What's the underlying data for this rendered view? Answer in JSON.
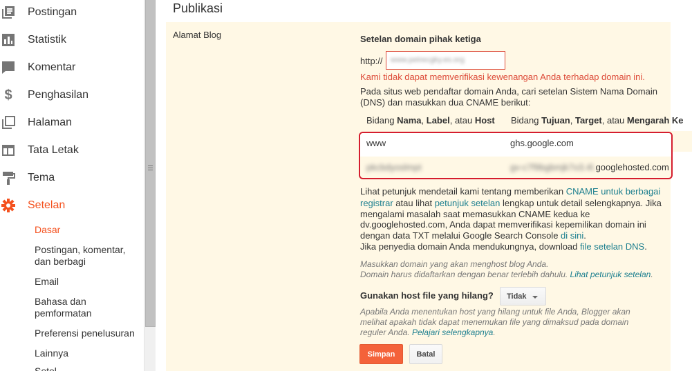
{
  "sidebar": {
    "items": [
      {
        "label": "Postingan",
        "icon": "posts-icon"
      },
      {
        "label": "Statistik",
        "icon": "stats-icon"
      },
      {
        "label": "Komentar",
        "icon": "comments-icon"
      },
      {
        "label": "Penghasilan",
        "icon": "dollar-icon"
      },
      {
        "label": "Halaman",
        "icon": "pages-icon"
      },
      {
        "label": "Tata Letak",
        "icon": "layout-icon"
      },
      {
        "label": "Tema",
        "icon": "paint-roller-icon"
      },
      {
        "label": "Setelan",
        "icon": "gear-icon"
      }
    ],
    "sub_items": [
      "Dasar",
      "Postingan, komentar, dan berbagi",
      "Email",
      "Bahasa dan pemformatan",
      "Preferensi penelusuran",
      "Lainnya",
      "Setel"
    ],
    "active_color": "#f4511e"
  },
  "main": {
    "title": "Publikasi",
    "field_label": "Alamat Blog",
    "config_title": "Setelan domain pihak ketiga",
    "http_prefix": "http://",
    "domain_value": "www.petrecgky.es.org",
    "error": "Kami tidak dapat memverifikasi kewenangan Anda terhadap domain ini.",
    "intro_line1": "Pada situs web pendaftar domain Anda, cari setelan Sistem Nama Domain",
    "intro_line2": "(DNS) dan masukkan dua CNAME berikut:",
    "col1": {
      "pre": "Bidang ",
      "b1": "Nama",
      "sep1": ", ",
      "b2": "Label",
      "sep2": ", atau ",
      "b3": "Host"
    },
    "col2": {
      "pre": "Bidang ",
      "b1": "Tujuan",
      "sep1": ", ",
      "b2": "Target",
      "sep2": ", atau ",
      "b3": "Mengarah Ke"
    },
    "cname_rows": [
      {
        "name": "www",
        "target": "ghs.google.com"
      },
      {
        "name": "pkcbdyoslmpt",
        "target_prefix": "gv-c7f9bgbmjk7o3.4l.",
        "target_suffix": "googlehosted.com"
      }
    ],
    "help": {
      "l1_a": "Lihat petunjuk mendetail kami tentang memberikan ",
      "l1_link": "CNAME untuk berbagai",
      "l2_link1": "registrar",
      "l2_b": " atau lihat ",
      "l2_link2": "petunjuk setelan",
      "l2_c": " lengkap untuk detail selengkapnya. Jika",
      "l3": "mengalami masalah saat memasukkan CNAME kedua ke",
      "l4": "dv.googlehosted.com, Anda dapat memverifikasi kepemilikan domain ini",
      "l5_a": "dengan data TXT melalui Google Search Console ",
      "l5_link": "di sini",
      "l5_b": ".",
      "l6_a": "Jika penyedia domain Anda mendukungnya, download ",
      "l6_link": "file setelan DNS",
      "l6_b": "."
    },
    "hint1": "Masukkan domain yang akan menghost blog Anda.",
    "hint2_a": "Domain harus didaftarkan dengan benar terlebih dahulu. ",
    "hint2_link": "Lihat petunjuk setelan",
    "hint2_b": ".",
    "host_question": "Gunakan host file yang hilang?",
    "host_select": "Tidak",
    "host_hint1": "Apabila Anda menentukan host yang hilang untuk file Anda, Blogger akan",
    "host_hint2": "melihat apakah tidak dapat menemukan file yang dimaksud pada domain",
    "host_hint3_a": "reguler Anda. ",
    "host_hint3_link": "Pelajari selengkapnya",
    "host_hint3_b": ".",
    "save": "Simpan",
    "cancel": "Batal"
  }
}
